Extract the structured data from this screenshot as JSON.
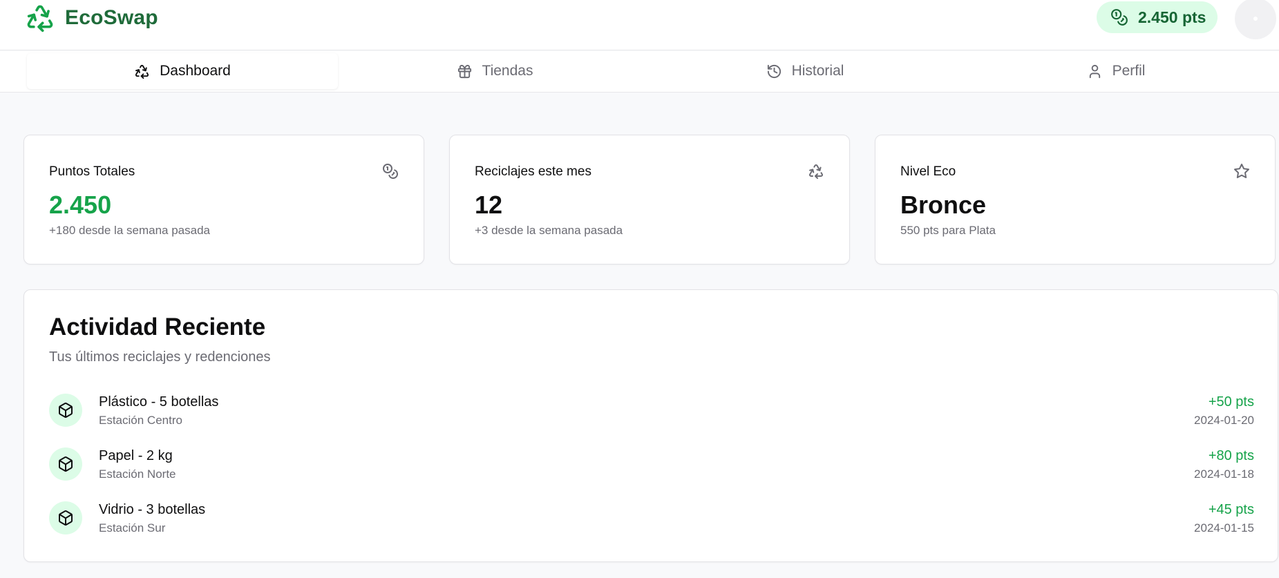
{
  "brand": {
    "name": "EcoSwap",
    "icon": "recycle-icon"
  },
  "header": {
    "points": "2.450 pts",
    "points_icon": "coins-icon",
    "avatar_icon": "avatar"
  },
  "colors": {
    "accent": "#16a34a",
    "brand_dark": "#1f6b3a",
    "pill_bg": "#dcfce7",
    "pill_text": "#166534",
    "muted": "#6b6b73"
  },
  "tabs": [
    {
      "label": "Dashboard",
      "icon": "recycle-icon",
      "active": true
    },
    {
      "label": "Tiendas",
      "icon": "gift-icon",
      "active": false
    },
    {
      "label": "Historial",
      "icon": "history-icon",
      "active": false
    },
    {
      "label": "Perfil",
      "icon": "user-icon",
      "active": false
    }
  ],
  "stats": [
    {
      "label": "Puntos Totales",
      "value": "2.450",
      "sub": "+180 desde la semana pasada",
      "icon": "coins-icon"
    },
    {
      "label": "Reciclajes este mes",
      "value": "12",
      "sub": "+3 desde la semana pasada",
      "icon": "recycle-icon"
    },
    {
      "label": "Nivel Eco",
      "value": "Bronce",
      "sub": "550 pts para Plata",
      "icon": "star-icon"
    }
  ],
  "activity": {
    "title": "Actividad Reciente",
    "subtitle": "Tus últimos reciclajes y redenciones",
    "items": [
      {
        "name": "Plástico - 5 botellas",
        "station": "Estación Centro",
        "points": "+50 pts",
        "date": "2024-01-20",
        "icon": "package-icon"
      },
      {
        "name": "Papel - 2 kg",
        "station": "Estación Norte",
        "points": "+80 pts",
        "date": "2024-01-18",
        "icon": "package-icon"
      },
      {
        "name": "Vidrio - 3 botellas",
        "station": "Estación Sur",
        "points": "+45 pts",
        "date": "2024-01-15",
        "icon": "package-icon"
      }
    ]
  }
}
